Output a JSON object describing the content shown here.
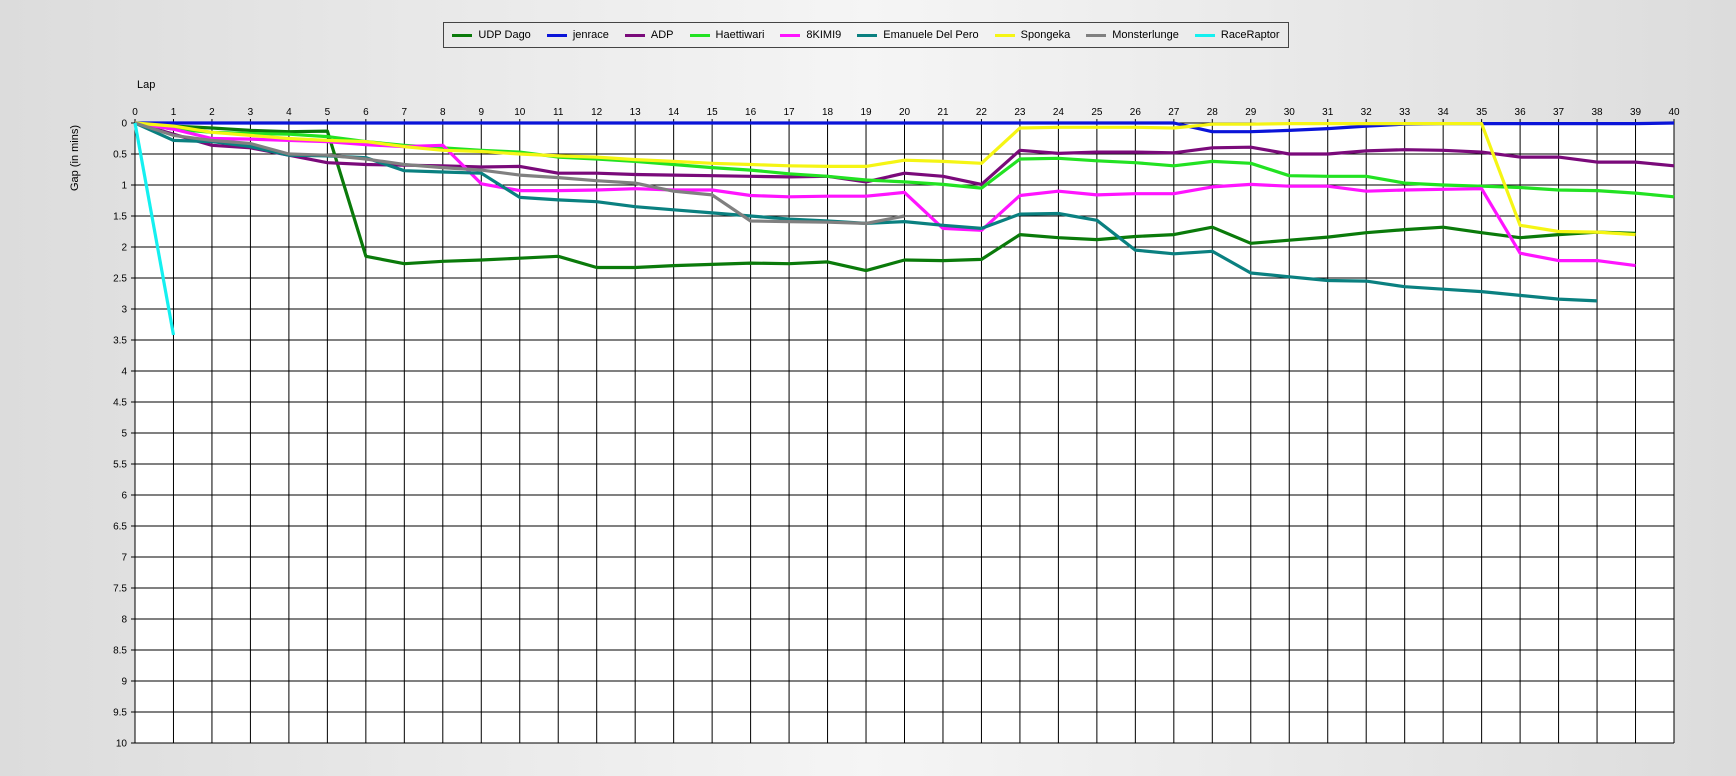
{
  "chart_data": {
    "type": "line",
    "xlabel": "Lap",
    "ylabel": "Gap (in mins)",
    "xlim": [
      0,
      40
    ],
    "ylim": [
      0,
      10
    ],
    "y_inverted": true,
    "grid": true,
    "legend_position": "top-center",
    "x_ticks": [
      0,
      1,
      2,
      3,
      4,
      5,
      6,
      7,
      8,
      9,
      10,
      11,
      12,
      13,
      14,
      15,
      16,
      17,
      18,
      19,
      20,
      21,
      22,
      23,
      24,
      25,
      26,
      27,
      28,
      29,
      30,
      31,
      32,
      33,
      34,
      35,
      36,
      37,
      38,
      39,
      40
    ],
    "y_ticks": [
      "0",
      "0.5",
      "1",
      "1.5",
      "2",
      "2.5",
      "3",
      "3.5",
      "4",
      "4.5",
      "5",
      "5.5",
      "6",
      "6.5",
      "7",
      "7.5",
      "8",
      "8.5",
      "9",
      "9.5",
      "10"
    ],
    "series": [
      {
        "name": "UDP Dago",
        "color": "#0a7a0a",
        "values": [
          0,
          0.05,
          0.08,
          0.12,
          0.14,
          0.13,
          2.15,
          2.27,
          2.23,
          2.21,
          2.18,
          2.15,
          2.33,
          2.33,
          2.3,
          2.28,
          2.26,
          2.27,
          2.24,
          2.38,
          2.21,
          2.22,
          2.2,
          1.8,
          1.85,
          1.88,
          1.83,
          1.8,
          1.68,
          1.94,
          1.89,
          1.84,
          1.77,
          1.72,
          1.68,
          1.77,
          1.85,
          1.8,
          1.76,
          1.78
        ]
      },
      {
        "name": "jenrace",
        "color": "#0a14d8",
        "values": [
          0,
          0,
          0,
          0,
          0,
          0,
          0,
          0,
          0,
          0,
          0,
          0,
          0,
          0,
          0,
          0,
          0,
          0,
          0,
          0,
          0,
          0,
          0,
          0,
          0,
          0,
          0,
          0,
          0.14,
          0.14,
          0.12,
          0.09,
          0.05,
          0.02,
          0.01,
          0.01,
          0.01,
          0.01,
          0.01,
          0.01,
          0
        ]
      },
      {
        "name": "ADP",
        "color": "#7a0a7a",
        "values": [
          0,
          0.18,
          0.36,
          0.4,
          0.52,
          0.64,
          0.67,
          0.68,
          0.69,
          0.71,
          0.7,
          0.81,
          0.81,
          0.83,
          0.84,
          0.85,
          0.86,
          0.87,
          0.86,
          0.95,
          0.81,
          0.86,
          0.99,
          0.44,
          0.49,
          0.47,
          0.47,
          0.48,
          0.4,
          0.39,
          0.5,
          0.5,
          0.45,
          0.43,
          0.44,
          0.47,
          0.55,
          0.55,
          0.63,
          0.63,
          0.69
        ]
      },
      {
        "name": "Haettiwari",
        "color": "#22e222",
        "values": [
          0,
          0.1,
          0.15,
          0.17,
          0.18,
          0.22,
          0.3,
          0.36,
          0.4,
          0.44,
          0.47,
          0.55,
          0.58,
          0.62,
          0.67,
          0.72,
          0.76,
          0.82,
          0.86,
          0.92,
          0.95,
          0.99,
          1.05,
          0.58,
          0.57,
          0.61,
          0.64,
          0.69,
          0.62,
          0.65,
          0.85,
          0.86,
          0.86,
          0.97,
          1.0,
          1.02,
          1.04,
          1.08,
          1.09,
          1.13,
          1.19
        ]
      },
      {
        "name": "8KIMI9",
        "color": "#ff14ff",
        "values": [
          0,
          0.1,
          0.25,
          0.26,
          0.28,
          0.3,
          0.35,
          0.38,
          0.36,
          0.98,
          1.09,
          1.09,
          1.08,
          1.06,
          1.08,
          1.08,
          1.17,
          1.19,
          1.18,
          1.18,
          1.12,
          1.7,
          1.73,
          1.17,
          1.1,
          1.16,
          1.14,
          1.14,
          1.03,
          0.99,
          1.02,
          1.02,
          1.1,
          1.08,
          1.07,
          1.06,
          2.1,
          2.22,
          2.22,
          2.3
        ]
      },
      {
        "name": "Emanuele Del Pero",
        "color": "#0a8080",
        "values": [
          0,
          0.28,
          0.3,
          0.38,
          0.52,
          0.53,
          0.56,
          0.77,
          0.79,
          0.81,
          1.2,
          1.24,
          1.27,
          1.35,
          1.4,
          1.45,
          1.5,
          1.55,
          1.58,
          1.62,
          1.59,
          1.65,
          1.7,
          1.47,
          1.46,
          1.57,
          2.05,
          2.11,
          2.07,
          2.42,
          2.48,
          2.54,
          2.55,
          2.64,
          2.68,
          2.72,
          2.78,
          2.84,
          2.87
        ]
      },
      {
        "name": "Spongeka",
        "color": "#f5f514",
        "values": [
          0,
          0.05,
          0.15,
          0.2,
          0.25,
          0.28,
          0.3,
          0.38,
          0.44,
          0.46,
          0.5,
          0.53,
          0.55,
          0.59,
          0.62,
          0.65,
          0.67,
          0.69,
          0.7,
          0.7,
          0.6,
          0.62,
          0.65,
          0.08,
          0.07,
          0.07,
          0.07,
          0.08,
          0.02,
          0.02,
          0.01,
          0.01,
          0.01,
          0.01,
          0.01,
          0.01,
          1.65,
          1.75,
          1.76,
          1.8
        ]
      },
      {
        "name": "Monsterlunge",
        "color": "#808080",
        "values": [
          0,
          0.2,
          0.28,
          0.33,
          0.5,
          0.52,
          0.58,
          0.67,
          0.72,
          0.76,
          0.84,
          0.88,
          0.93,
          0.97,
          1.1,
          1.16,
          1.58,
          1.59,
          1.6,
          1.62,
          1.5
        ]
      },
      {
        "name": "RaceRaptor",
        "color": "#14f0f0",
        "values": [
          0,
          3.42
        ]
      }
    ]
  }
}
